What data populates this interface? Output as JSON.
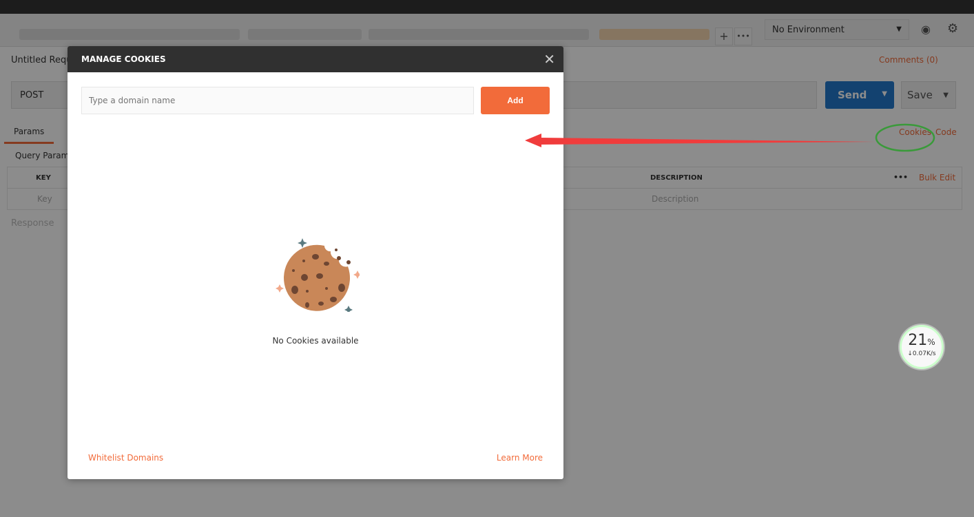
{
  "app": {
    "environment": "No Environment",
    "request_title": "Untitled Requ",
    "comments": "Comments (0)"
  },
  "request": {
    "method": "POST",
    "send": "Send",
    "save": "Save"
  },
  "tabs": {
    "params": "Params",
    "cookies": "Cookies",
    "code": "Code"
  },
  "params": {
    "title": "Query Param",
    "col_key": "KEY",
    "col_description": "DESCRIPTION",
    "key_placeholder": "Key",
    "description_placeholder": "Description",
    "bulk_edit": "Bulk Edit",
    "more": "•••"
  },
  "response": {
    "label": "Response"
  },
  "modal": {
    "title": "MANAGE COOKIES",
    "domain_placeholder": "Type a domain name",
    "add": "Add",
    "empty": "No Cookies available",
    "whitelist": "Whitelist Domains",
    "learn_more": "Learn More"
  },
  "speed_widget": {
    "percent": "21",
    "unit": "%",
    "rate": "↓0.07K/s"
  },
  "colors": {
    "accent": "#f26b3a",
    "send": "#2478cc",
    "annotation_arrow": "#f03c3c",
    "annotation_circle": "#3a9a3a"
  }
}
